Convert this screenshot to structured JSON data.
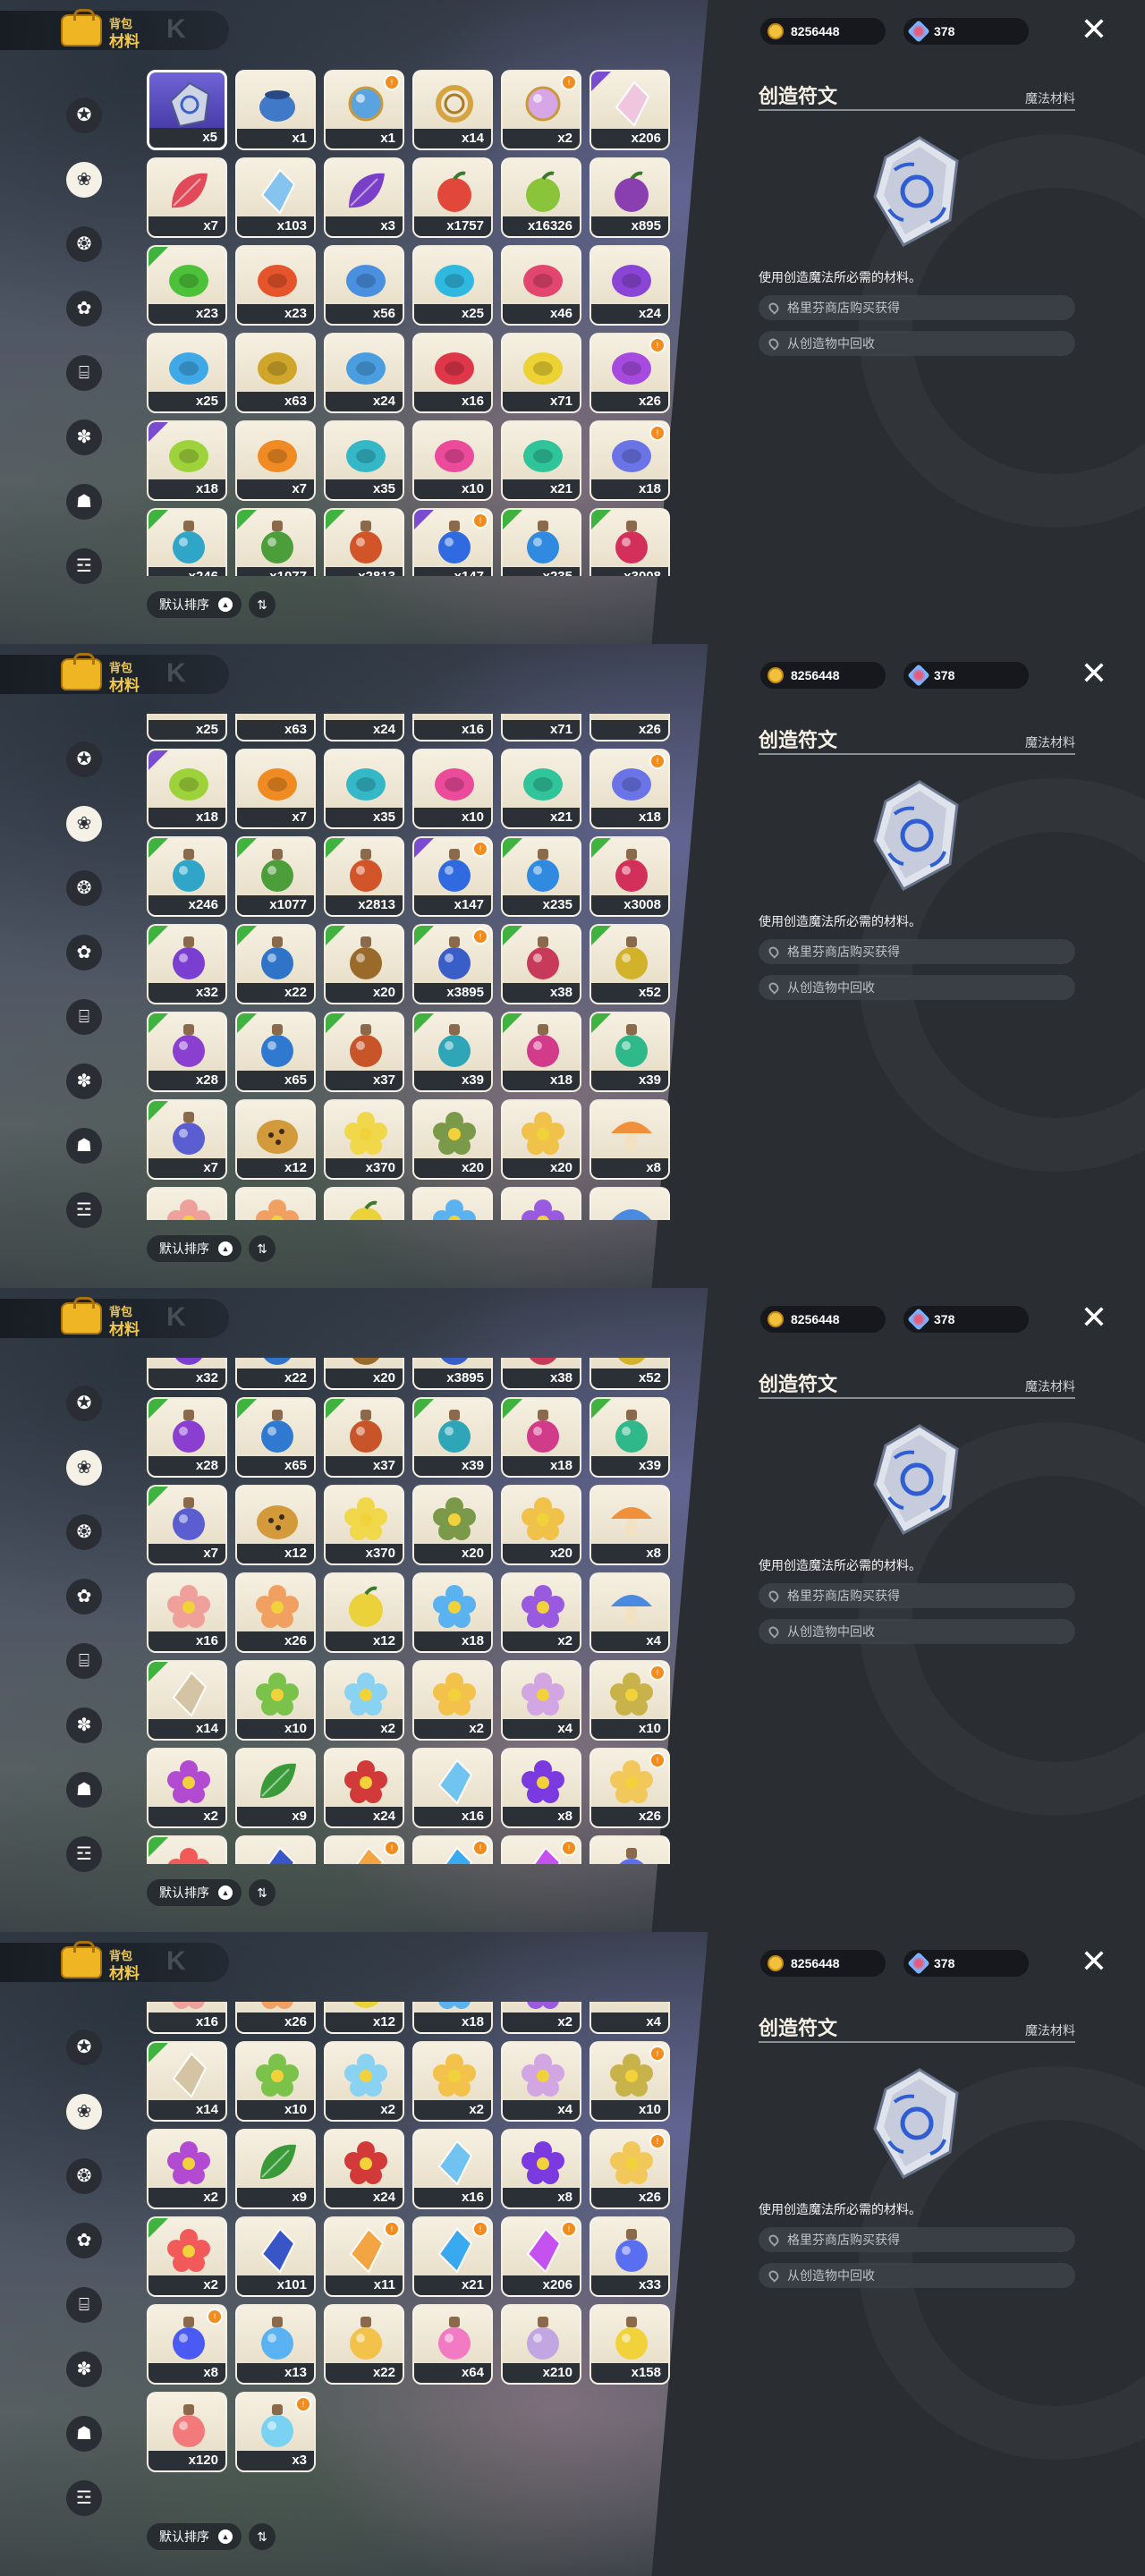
{
  "header": {
    "bag_label": "背包",
    "tab_label": "材料"
  },
  "currency": {
    "gold": "8256448",
    "gems": "378"
  },
  "close_label": "✕",
  "sidebar": {
    "items": [
      {
        "icon": "✪",
        "name": "sidebar-item-general"
      },
      {
        "icon": "❀",
        "name": "sidebar-item-materials"
      },
      {
        "icon": "❂",
        "name": "sidebar-item-magic"
      },
      {
        "icon": "✿",
        "name": "sidebar-item-flowers"
      },
      {
        "icon": "⌸",
        "name": "sidebar-item-tools"
      },
      {
        "icon": "✽",
        "name": "sidebar-item-seeds"
      },
      {
        "icon": "☗",
        "name": "sidebar-item-special"
      },
      {
        "icon": "☲",
        "name": "sidebar-item-box"
      }
    ],
    "active_index": 1
  },
  "detail": {
    "title": "创造符文",
    "type": "魔法材料",
    "description": "使用创造魔法所必需的材料。",
    "sources": [
      "格里芬商店购买获得",
      "从创造物中回收"
    ]
  },
  "sort": {
    "label": "默认排序",
    "direction_icon": "▲",
    "order_icon": "⇅"
  },
  "items": [
    {
      "count": "x5",
      "color": "#8a8fd6",
      "shape": "rune",
      "sel": true
    },
    {
      "count": "x1",
      "color": "#3f79c7",
      "shape": "pot"
    },
    {
      "count": "x1",
      "color": "#5aa3e0",
      "shape": "orb",
      "new": true
    },
    {
      "count": "x14",
      "color": "#d6a341",
      "shape": "ring"
    },
    {
      "count": "x2",
      "color": "#d7a6e6",
      "shape": "orb",
      "new": true
    },
    {
      "count": "x206",
      "color": "#f0c4e0",
      "shape": "crystal",
      "tri": "p"
    },
    {
      "count": "x7",
      "color": "#e24a5a",
      "shape": "leaf"
    },
    {
      "count": "x103",
      "color": "#7fc2f0",
      "shape": "crystal"
    },
    {
      "count": "x3",
      "color": "#7a3fc9",
      "shape": "leaf"
    },
    {
      "count": "x1757",
      "color": "#e2483a",
      "shape": "fruit"
    },
    {
      "count": "x16326",
      "color": "#8ac43a",
      "shape": "fruit"
    },
    {
      "count": "x895",
      "color": "#8a3fb0",
      "shape": "fruit"
    },
    {
      "count": "x23",
      "color": "#4cc23a",
      "shape": "seed",
      "tri": "g"
    },
    {
      "count": "x23",
      "color": "#e5542a",
      "shape": "seed"
    },
    {
      "count": "x56",
      "color": "#4a8fe0",
      "shape": "seed"
    },
    {
      "count": "x25",
      "color": "#2fb8e0",
      "shape": "seed"
    },
    {
      "count": "x46",
      "color": "#e2456e",
      "shape": "seed"
    },
    {
      "count": "x24",
      "color": "#8a45d6",
      "shape": "seed"
    },
    {
      "count": "x25",
      "color": "#3fa8e6",
      "shape": "seed"
    },
    {
      "count": "x63",
      "color": "#d0a62a",
      "shape": "seed"
    },
    {
      "count": "x24",
      "color": "#4a9ee0",
      "shape": "seed"
    },
    {
      "count": "x16",
      "color": "#e0364a",
      "shape": "seed"
    },
    {
      "count": "x71",
      "color": "#ecd232",
      "shape": "seed"
    },
    {
      "count": "x26",
      "color": "#a64ae0",
      "shape": "seed",
      "new": true
    },
    {
      "count": "x18",
      "color": "#9ed23a",
      "shape": "seed",
      "tri": "p"
    },
    {
      "count": "x7",
      "color": "#f08a22",
      "shape": "seed"
    },
    {
      "count": "x35",
      "color": "#34b8c8",
      "shape": "seed"
    },
    {
      "count": "x10",
      "color": "#ec4a9a",
      "shape": "seed"
    },
    {
      "count": "x21",
      "color": "#2fc49a",
      "shape": "seed"
    },
    {
      "count": "x18",
      "color": "#6a74e6",
      "shape": "seed",
      "new": true
    },
    {
      "count": "x246",
      "color": "#2fa6c8",
      "shape": "bottle",
      "tri": "g"
    },
    {
      "count": "x1077",
      "color": "#4c9e3a",
      "shape": "bottle",
      "tri": "g"
    },
    {
      "count": "x2813",
      "color": "#d2552a",
      "shape": "bottle",
      "tri": "g"
    },
    {
      "count": "x147",
      "color": "#2f6ae0",
      "shape": "bottle",
      "tri": "p",
      "new": true
    },
    {
      "count": "x235",
      "color": "#2f8ae0",
      "shape": "bottle",
      "tri": "g"
    },
    {
      "count": "x3008",
      "color": "#d2305a",
      "shape": "bottle",
      "tri": "g"
    },
    {
      "count": "x32",
      "color": "#7a3fd0",
      "shape": "bottle",
      "tri": "g"
    },
    {
      "count": "x22",
      "color": "#2f74c8",
      "shape": "bottle",
      "tri": "g"
    },
    {
      "count": "x20",
      "color": "#9a6a2a",
      "shape": "bottle",
      "tri": "g"
    },
    {
      "count": "x3895",
      "color": "#3a5ec8",
      "shape": "bottle",
      "tri": "g",
      "new": true
    },
    {
      "count": "x38",
      "color": "#c83a5a",
      "shape": "bottle",
      "tri": "g"
    },
    {
      "count": "x52",
      "color": "#d2b22a",
      "shape": "bottle",
      "tri": "g"
    },
    {
      "count": "x28",
      "color": "#8a3fd0",
      "shape": "bottle",
      "tri": "g"
    },
    {
      "count": "x65",
      "color": "#2f7ad0",
      "shape": "bottle",
      "tri": "g"
    },
    {
      "count": "x37",
      "color": "#c8542a",
      "shape": "bottle",
      "tri": "g"
    },
    {
      "count": "x39",
      "color": "#2fa6b8",
      "shape": "bottle",
      "tri": "g"
    },
    {
      "count": "x18",
      "color": "#d23a8a",
      "shape": "bottle",
      "tri": "g"
    },
    {
      "count": "x39",
      "color": "#2fb88a",
      "shape": "bottle",
      "tri": "g"
    },
    {
      "count": "x7",
      "color": "#5a5ed0",
      "shape": "bottle",
      "tri": "g"
    },
    {
      "count": "x12",
      "color": "#d29a3a",
      "shape": "pumpkin"
    },
    {
      "count": "x370",
      "color": "#f0d84a",
      "shape": "flower"
    },
    {
      "count": "x20",
      "color": "#7a9a4a",
      "shape": "flower"
    },
    {
      "count": "x20",
      "color": "#f0c24a",
      "shape": "flower"
    },
    {
      "count": "x8",
      "color": "#f0903a",
      "shape": "mushroom"
    },
    {
      "count": "x16",
      "color": "#f0a09a",
      "shape": "flower"
    },
    {
      "count": "x26",
      "color": "#f2a062",
      "shape": "flower"
    },
    {
      "count": "x12",
      "color": "#ecd23a",
      "shape": "fruit"
    },
    {
      "count": "x18",
      "color": "#5ab2f0",
      "shape": "flower"
    },
    {
      "count": "x2",
      "color": "#9a5ae0",
      "shape": "flower"
    },
    {
      "count": "x4",
      "color": "#4a8ae0",
      "shape": "mushroom"
    },
    {
      "count": "x14",
      "color": "#d2c2a2",
      "shape": "crystal",
      "tri": "g"
    },
    {
      "count": "x10",
      "color": "#7ac24a",
      "shape": "flower"
    },
    {
      "count": "x2",
      "color": "#8ad2f2",
      "shape": "flower"
    },
    {
      "count": "x2",
      "color": "#f2c24a",
      "shape": "flower"
    },
    {
      "count": "x4",
      "color": "#d2a6e2",
      "shape": "flower"
    },
    {
      "count": "x10",
      "color": "#c8b24a",
      "shape": "flower",
      "new": true
    },
    {
      "count": "x2",
      "color": "#b24ad2",
      "shape": "flower"
    },
    {
      "count": "x9",
      "color": "#3a9a3a",
      "shape": "leaf"
    },
    {
      "count": "x24",
      "color": "#d23a3a",
      "shape": "flower"
    },
    {
      "count": "x16",
      "color": "#6ac2f2",
      "shape": "crystal"
    },
    {
      "count": "x8",
      "color": "#7a3ae0",
      "shape": "flower"
    },
    {
      "count": "x26",
      "color": "#f2c85a",
      "shape": "flower",
      "new": true
    },
    {
      "count": "x2",
      "color": "#f25a5a",
      "shape": "flower",
      "tri": "g"
    },
    {
      "count": "x101",
      "color": "#2f4ec8",
      "shape": "crystal"
    },
    {
      "count": "x11",
      "color": "#f2a23a",
      "shape": "crystal",
      "new": true
    },
    {
      "count": "x21",
      "color": "#2fa6f2",
      "shape": "crystal",
      "new": true
    },
    {
      "count": "x206",
      "color": "#c24af2",
      "shape": "crystal",
      "new": true
    },
    {
      "count": "x33",
      "color": "#5a6ef2",
      "shape": "bottle"
    },
    {
      "count": "x8",
      "color": "#4a5af2",
      "shape": "bottle",
      "new": true
    },
    {
      "count": "x13",
      "color": "#5ab2f2",
      "shape": "bottle"
    },
    {
      "count": "x22",
      "color": "#f2c24a",
      "shape": "bottle"
    },
    {
      "count": "x64",
      "color": "#f27ac2",
      "shape": "bottle"
    },
    {
      "count": "x210",
      "color": "#c2a6e2",
      "shape": "bottle"
    },
    {
      "count": "x158",
      "color": "#f2d23a",
      "shape": "bottle"
    },
    {
      "count": "x120",
      "color": "#f27a7a",
      "shape": "bottle"
    },
    {
      "count": "x3",
      "color": "#7ad2f2",
      "shape": "bottle",
      "new": true
    }
  ],
  "panels": [
    {
      "scroll_row": 0
    },
    {
      "scroll_row": 3.6
    },
    {
      "scroll_row": 6.55
    },
    {
      "scroll_row": 9.55
    }
  ]
}
